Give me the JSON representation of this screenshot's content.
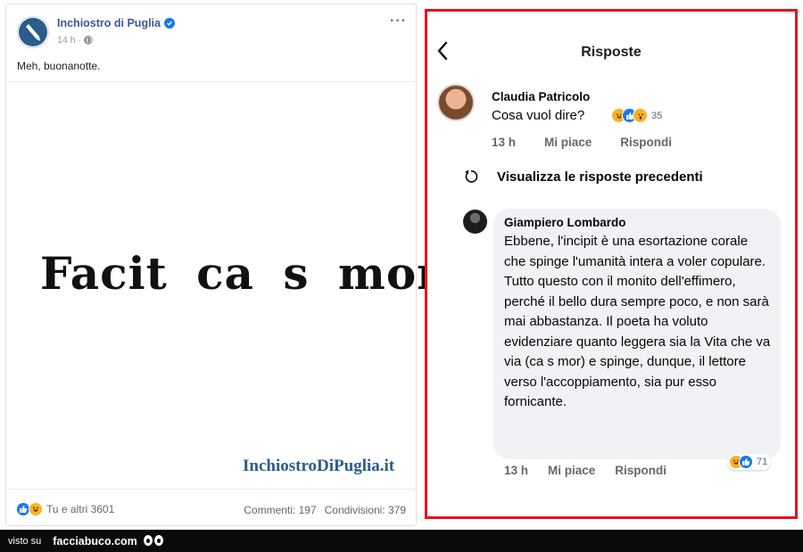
{
  "post": {
    "page_name": "Inchiostro di Puglia",
    "time": "14 h",
    "text": "Meh, buonanotte.",
    "image_quote": "Facit ca s mor.",
    "image_watermark": "InchiostroDiPuglia.it",
    "reactions_label": "Tu e altri 3601",
    "comments": "Commenti: 197",
    "shares": "Condivisioni: 379",
    "icons": [
      "pen-logo-icon",
      "verified-icon",
      "globe-icon",
      "more-icon",
      "like-icon",
      "haha-icon"
    ],
    "colors": {
      "link": "#385898",
      "verified": "#1877f2"
    }
  },
  "replies_panel": {
    "title": "Risposte",
    "back_icon": "chevron-left-icon",
    "border_color": "#e5141c",
    "comment1": {
      "author": "Claudia Patricolo",
      "text": "Cosa vuol dire?",
      "reaction_count": "35",
      "time": "13 h",
      "like_label": "Mi piace",
      "reply_label": "Rispondi"
    },
    "previous_replies_label": "Visualizza le risposte precedenti",
    "comment2": {
      "author": "Giampiero Lombardo",
      "text": "Ebbene, l'incipit è una esortazione corale che spinge l'umanità intera a voler copulare. Tutto questo con il monito dell'effimero, perché il bello dura sempre poco, e non sarà mai abbastanza. Il poeta ha voluto evidenziare quanto leggera sia la Vita che va via (ca s mor) e spinge, dunque, il lettore verso l'accoppiamento, sia pur esso fornicante.",
      "reaction_count": "71",
      "time": "13 h",
      "like_label": "Mi piace",
      "reply_label": "Rispondi"
    }
  },
  "footer_bar": {
    "visto_label": "visto su",
    "brand": "facciabuco.com"
  }
}
